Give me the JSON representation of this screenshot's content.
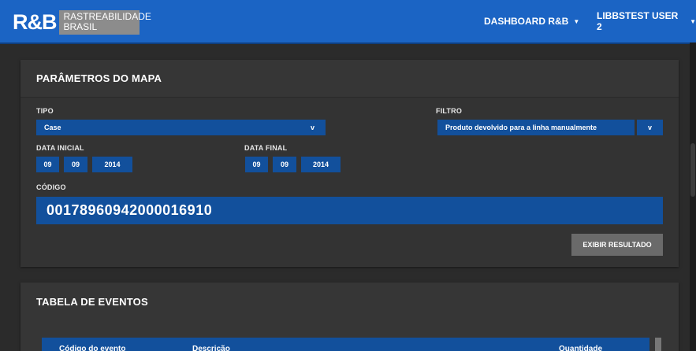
{
  "header": {
    "logo_mark": "R&B",
    "logo_line1": "RASTREABILIDADE",
    "logo_line2": "BRASIL",
    "nav_dashboard": "DASHBOARD R&B",
    "nav_user": "LIBBSTEST USER 2"
  },
  "params": {
    "title": "PARÂMETROS DO MAPA",
    "tipo_label": "TIPO",
    "tipo_value": "Case",
    "tipo_arrow": "v",
    "filtro_label": "FILTRO",
    "filtro_value": "Produto devolvido para a linha manualmente",
    "filtro_arrow": "v",
    "data_inicial_label": "DATA INICIAL",
    "data_inicial": {
      "day": "09",
      "month": "09",
      "year": "2014"
    },
    "data_final_label": "DATA FINAL",
    "data_final": {
      "day": "09",
      "month": "09",
      "year": "2014"
    },
    "codigo_label": "CÓDIGO",
    "codigo_value": "00178960942000016910",
    "button": "EXIBIR RESULTADO"
  },
  "events": {
    "title": "TABELA DE EVENTOS",
    "columns": [
      "Código do evento",
      "Descrição",
      "Quantidade"
    ]
  }
}
